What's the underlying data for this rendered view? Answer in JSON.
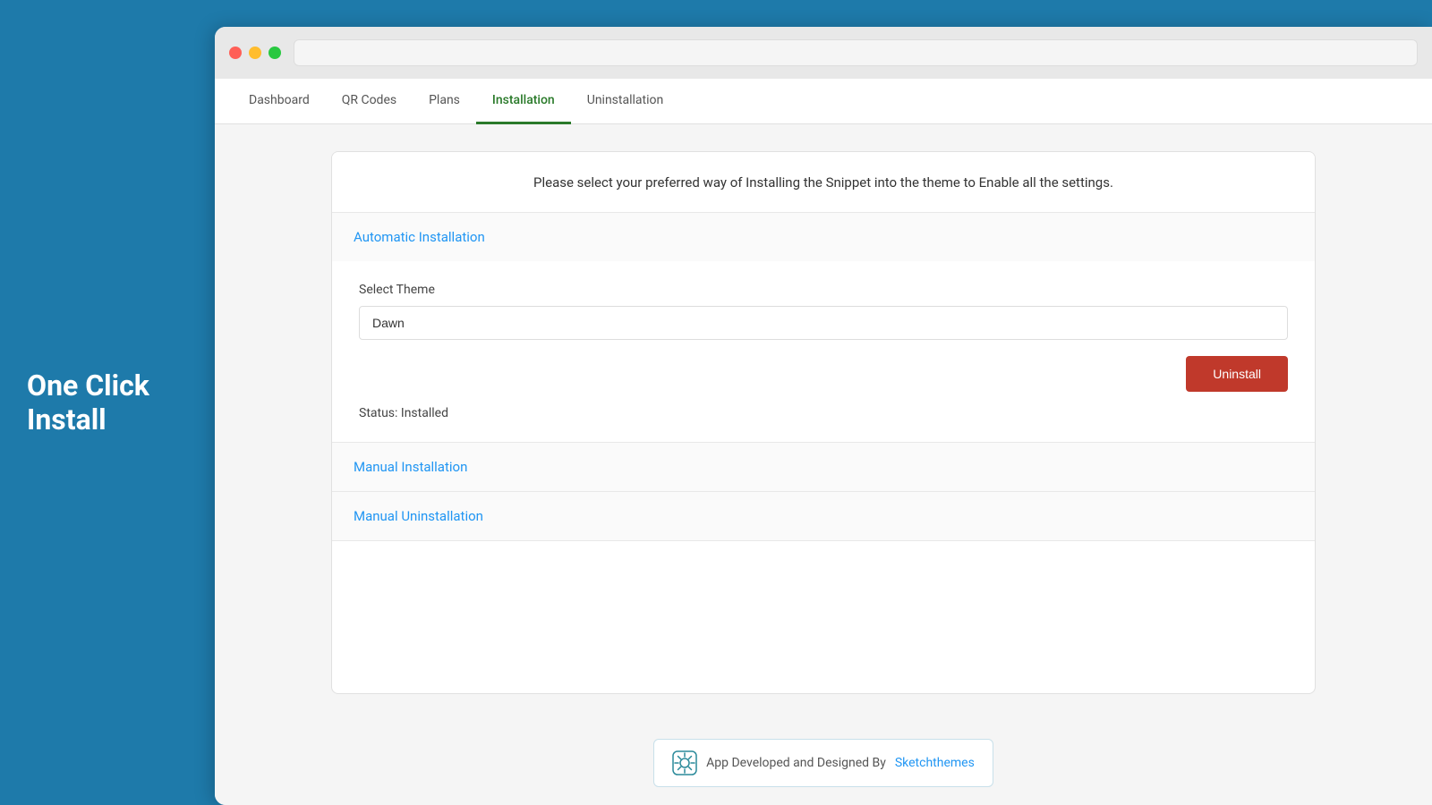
{
  "sidebar": {
    "title_line1": "One Click",
    "title_line2": "Install"
  },
  "browser": {
    "url_placeholder": ""
  },
  "nav": {
    "tabs": [
      {
        "label": "Dashboard",
        "active": false
      },
      {
        "label": "QR Codes",
        "active": false
      },
      {
        "label": "Plans",
        "active": false
      },
      {
        "label": "Installation",
        "active": true
      },
      {
        "label": "Uninstallation",
        "active": false
      }
    ]
  },
  "main": {
    "header_text": "Please select your preferred way of Installing the Snippet into the theme to Enable all the settings.",
    "accordion_auto": {
      "label": "Automatic Installation"
    },
    "accordion_auto_body": {
      "select_label": "Select Theme",
      "select_value": "Dawn",
      "uninstall_button": "Uninstall",
      "status_text": "Status: Installed"
    },
    "accordion_manual": {
      "label": "Manual Installation"
    },
    "accordion_manual_uninstall": {
      "label": "Manual Uninstallation"
    }
  },
  "footer": {
    "text": "App Developed and Designed By",
    "link_text": "Sketchthemes"
  },
  "colors": {
    "sidebar_bg": "#1e7aaa",
    "active_tab": "#2a7a2a",
    "link_blue": "#2196f3",
    "uninstall_btn": "#c0392b",
    "status_text": "#444444"
  }
}
